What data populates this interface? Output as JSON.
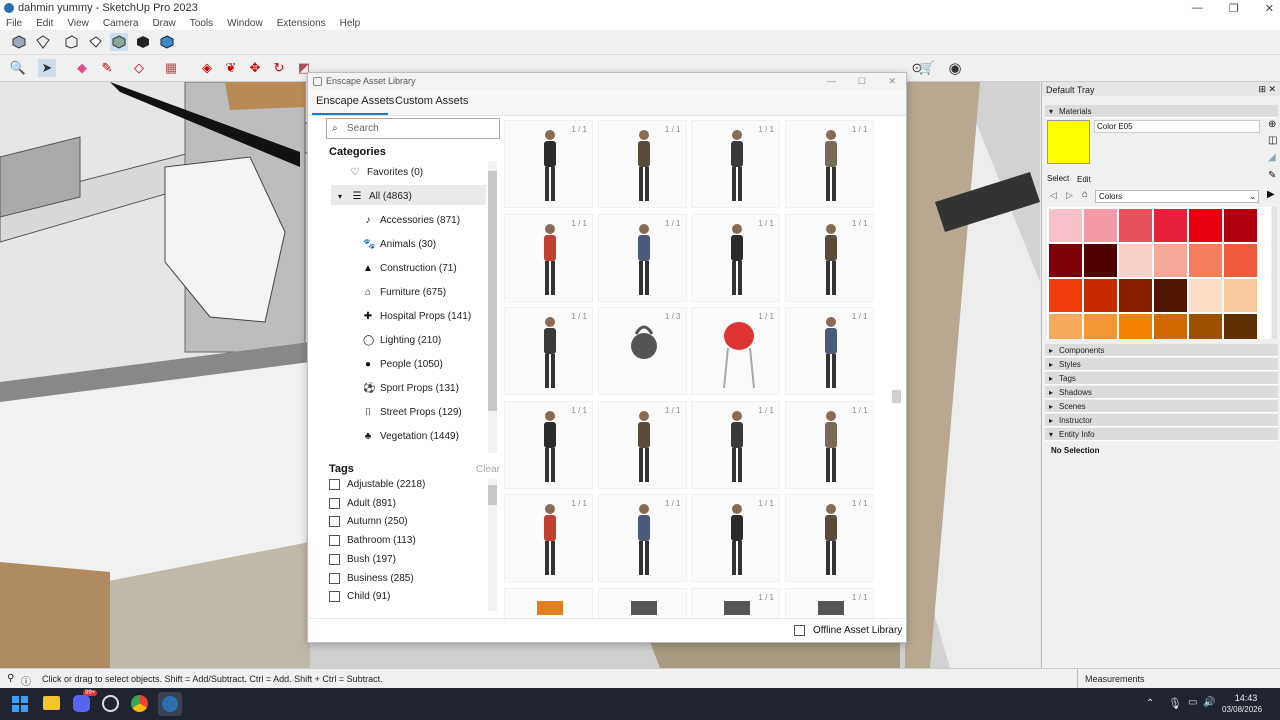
{
  "window": {
    "title": "dahmin yummy - SketchUp Pro 2023",
    "controls": [
      "—",
      "❐",
      "✕"
    ]
  },
  "menu": [
    "File",
    "Edit",
    "View",
    "Camera",
    "Draw",
    "Tools",
    "Window",
    "Extensions",
    "Help"
  ],
  "toolbar": {
    "icons_row1": [
      "cube-icon",
      "eraser-box-icon",
      "cube-outline-icon",
      "box-icon",
      "cube-shaded-icon",
      "cube-dark-icon",
      "cube-blue-icon"
    ],
    "icons_row2": [
      "zoom-icon",
      "select-arrow-icon",
      "eraser-icon",
      "pencil-icon",
      "shape-icon",
      "paint-icon",
      "pushpull-icon",
      "rotate-icon",
      "move-icon",
      "refresh-icon"
    ]
  },
  "dialog": {
    "title": "Enscape Asset Library",
    "tabs": [
      "Enscape Assets",
      "Custom Assets"
    ],
    "search_placeholder": "Search",
    "categories_heading": "Categories",
    "favorites": "Favorites (0)",
    "all": "All (4863)",
    "categories": [
      {
        "label": "Accessories (871)",
        "icon": "♪"
      },
      {
        "label": "Animals (30)",
        "icon": "🐾"
      },
      {
        "label": "Construction (71)",
        "icon": "▲"
      },
      {
        "label": "Furniture (675)",
        "icon": "⌂"
      },
      {
        "label": "Hospital Props (141)",
        "icon": "✚"
      },
      {
        "label": "Lighting (210)",
        "icon": "◯"
      },
      {
        "label": "People (1050)",
        "icon": "●"
      },
      {
        "label": "Sport Props (131)",
        "icon": "⚽"
      },
      {
        "label": "Street Props (129)",
        "icon": "⌷"
      },
      {
        "label": "Vegetation (1449)",
        "icon": "♣"
      }
    ],
    "tags_heading": "Tags",
    "clear_label": "Clear",
    "tags": [
      "Adjustable (2218)",
      "Adult (891)",
      "Autumn (250)",
      "Bathroom (113)",
      "Bush (197)",
      "Business (285)",
      "Child (91)"
    ],
    "offline_label": "Offline Asset Library",
    "grid": [
      [
        "1 / 1",
        "1 / 1",
        "1 / 1",
        "1 / 1"
      ],
      [
        "1 / 1",
        "1 / 1",
        "1 / 1",
        "1 / 1"
      ],
      [
        "1 / 1",
        "1 / 3",
        "1 / 1",
        "1 / 1"
      ],
      [
        "1 / 1",
        "1 / 1",
        "1 / 1",
        "1 / 1"
      ],
      [
        "1 / 1",
        "1 / 1",
        "1 / 1",
        "1 / 1"
      ],
      [
        "",
        "",
        "1 / 1",
        "1 / 1"
      ]
    ]
  },
  "tray": {
    "title": "Default Tray",
    "materials_label": "Materials",
    "material_name": "Color E05",
    "material_color": "#ffff00",
    "select_label": "Select",
    "edit_label": "Edit",
    "library": "Colors",
    "swatches": [
      "#f8c0c8",
      "#f39aa6",
      "#e8505e",
      "#e6213b",
      "#e8000f",
      "#b3000e",
      "#7c0005",
      "#500000",
      "#f9d0c8",
      "#f5a996",
      "#f47f5c",
      "#f05a3c",
      "#f03c0a",
      "#c82a00",
      "#8a1e00",
      "#501400",
      "#fbdcc5",
      "#f7c89e",
      "#f6a85c",
      "#f59632",
      "#f58200",
      "#d06a00",
      "#9c5000",
      "#603000"
    ],
    "sections": [
      "Components",
      "Styles",
      "Tags",
      "Shadows",
      "Scenes",
      "Instructor",
      "Entity Info"
    ],
    "entity_info": "No Selection"
  },
  "status": {
    "message": "Click or drag to select objects. Shift = Add/Subtract. Ctrl = Add. Shift + Ctrl = Subtract.",
    "measurements": "Measurements"
  },
  "taskbar": {
    "time": "14:43",
    "date": "03/08/2026",
    "badge": "99+"
  }
}
